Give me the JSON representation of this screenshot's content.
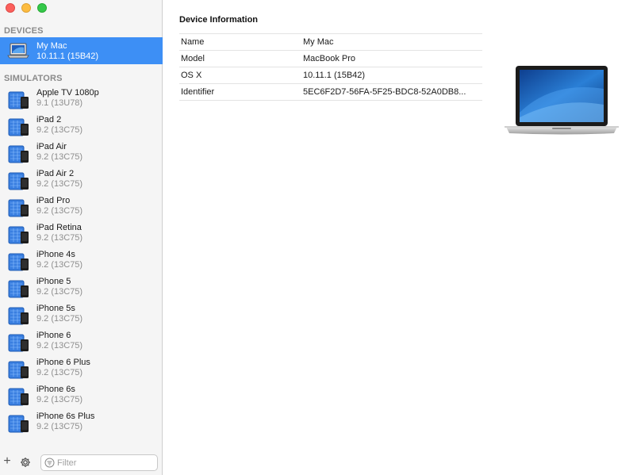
{
  "sidebar": {
    "devices_header": "DEVICES",
    "simulators_header": "SIMULATORS",
    "device": {
      "name": "My Mac",
      "version": "10.11.1 (15B42)",
      "icon": "laptop-icon"
    },
    "simulators": [
      {
        "name": "Apple TV 1080p",
        "version": "9.1 (13U78)"
      },
      {
        "name": "iPad 2",
        "version": "9.2 (13C75)"
      },
      {
        "name": "iPad Air",
        "version": "9.2 (13C75)"
      },
      {
        "name": "iPad Air 2",
        "version": "9.2 (13C75)"
      },
      {
        "name": "iPad Pro",
        "version": "9.2 (13C75)"
      },
      {
        "name": "iPad Retina",
        "version": "9.2 (13C75)"
      },
      {
        "name": "iPhone 4s",
        "version": "9.2 (13C75)"
      },
      {
        "name": "iPhone 5",
        "version": "9.2 (13C75)"
      },
      {
        "name": "iPhone 5s",
        "version": "9.2 (13C75)"
      },
      {
        "name": "iPhone 6",
        "version": "9.2 (13C75)"
      },
      {
        "name": "iPhone 6 Plus",
        "version": "9.2 (13C75)"
      },
      {
        "name": "iPhone 6s",
        "version": "9.2 (13C75)"
      },
      {
        "name": "iPhone 6s Plus",
        "version": "9.2 (13C75)"
      }
    ],
    "footer": {
      "add_label": "+",
      "filter_placeholder": "Filter"
    }
  },
  "main": {
    "title": "Device Information",
    "rows": [
      {
        "key": "Name",
        "value": "My Mac"
      },
      {
        "key": "Model",
        "value": "MacBook Pro"
      },
      {
        "key": "OS X",
        "value": "10.11.1 (15B42)"
      },
      {
        "key": "Identifier",
        "value": "5EC6F2D7-56FA-5F25-BDC8-52A0DB8..."
      }
    ],
    "device_image": "macbook-pro-image"
  },
  "colors": {
    "selection": "#3d8ff5",
    "sidebar_bg": "#f5f5f5",
    "secondary_text": "#8e8e8e"
  }
}
